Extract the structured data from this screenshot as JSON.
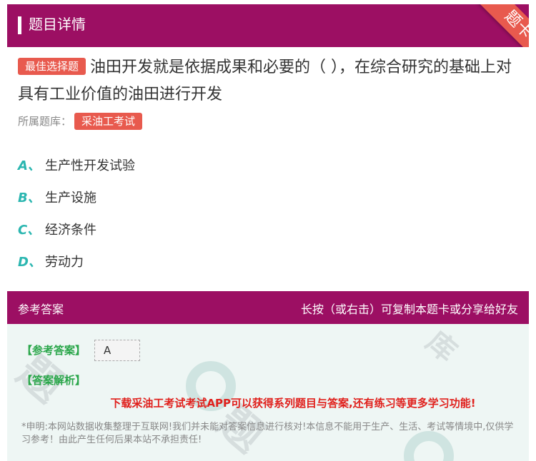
{
  "header": {
    "title": "题目详情",
    "ribbon": "题卡"
  },
  "question": {
    "type_tag": "最佳选择题",
    "text": "油田开发就是依据成果和必要的（ ），在综合研究的基础上对具有工业价值的油田进行开发",
    "source_label": "所属题库：",
    "source_tag": "采油工考试"
  },
  "options": [
    {
      "letter": "A、",
      "text": "生产性开发试验"
    },
    {
      "letter": "B、",
      "text": "生产设施"
    },
    {
      "letter": "C、",
      "text": "经济条件"
    },
    {
      "letter": "D、",
      "text": "劳动力"
    }
  ],
  "answer_bar": {
    "left": "参考答案",
    "right": "长按（或右击）可复制本题卡或分享给好友"
  },
  "answer": {
    "label": "【参考答案】",
    "value": "A",
    "analysis_label": "【答案解析】",
    "promo": "下载采油工考试考试APP可以获得系列题目与答案,还有练习等更多学习功能!",
    "disclaimer": "*申明:本网站数据收集整理于互联网!我们并未能对答案信息进行核对!本信息不能用于生产、生活、考试等情境中,仅供学习参考！由此产生任何后果本站不承担责任!"
  },
  "colors": {
    "brand": "#9c0f63",
    "tag": "#e85a4e",
    "option_letter": "#2bb6b0",
    "answer_green": "#2aa64a",
    "promo_red": "#e0201c"
  }
}
